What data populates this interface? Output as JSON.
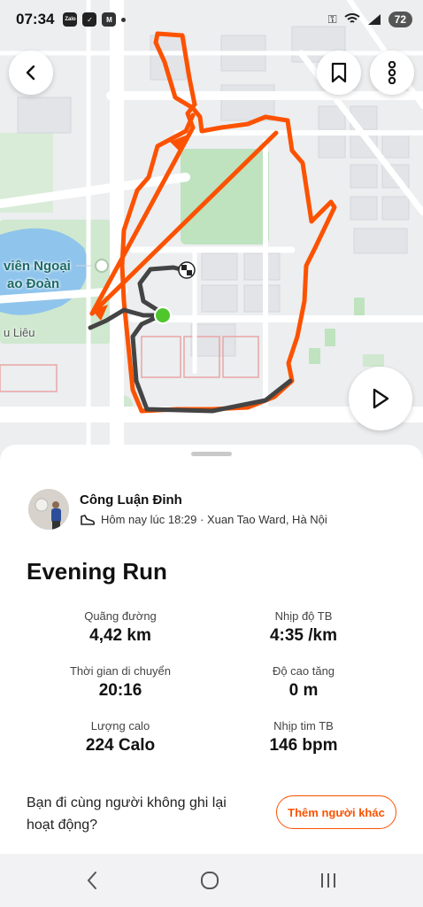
{
  "status_bar": {
    "time": "07:34",
    "app_icons": [
      "Zalo",
      "shield-check",
      "gmail"
    ],
    "battery": "72"
  },
  "map": {
    "labels": {
      "park_line1": "viên Ngoại",
      "park_line2": "ao Đoàn",
      "street": "u Liêu"
    },
    "route_color": "#fc5200",
    "start_color": "#4fc62b"
  },
  "activity": {
    "athlete_name": "Công Luận Đinh",
    "meta": "Hôm nay lúc 18:29 · Xuan Tao Ward, Hà Nội",
    "title": "Evening Run",
    "stats": [
      {
        "label": "Quãng đường",
        "value": "4,42 km"
      },
      {
        "label": "Nhịp độ TB",
        "value": "4:35 /km"
      },
      {
        "label": "Thời gian di chuyển",
        "value": "20:16"
      },
      {
        "label": "Độ cao tăng",
        "value": "0 m"
      },
      {
        "label": "Lượng calo",
        "value": "224 Calo"
      },
      {
        "label": "Nhịp tim TB",
        "value": "146 bpm"
      }
    ],
    "group_prompt": "Bạn đi cùng người không ghi lại hoạt động?",
    "add_button": "Thêm người khác"
  },
  "colors": {
    "accent": "#fc5200"
  }
}
